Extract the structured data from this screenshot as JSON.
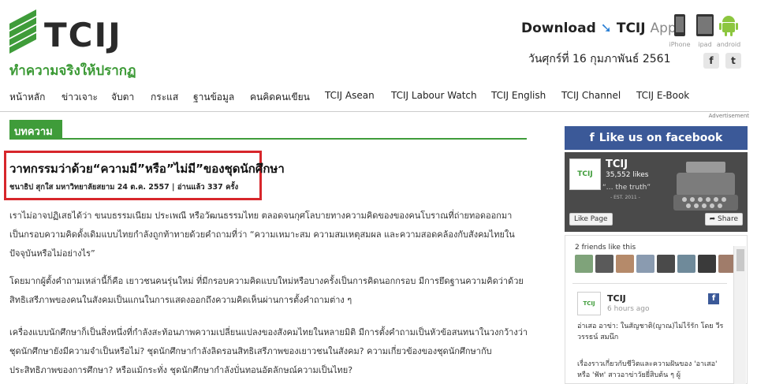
{
  "header": {
    "logo_text": "TCIJ",
    "tagline": "ทำความจริงให้ปรากฏ",
    "download": "Download",
    "download_brand": "TCIJ",
    "download_apps": "Apps",
    "devices": [
      "iPhone",
      "ipad",
      "android"
    ],
    "date": "วันศุกร์ที่ 16 กุมภาพันธ์ 2561",
    "social": {
      "facebook": "f",
      "twitter": "t"
    }
  },
  "nav": {
    "items": [
      "หน้าหลัก",
      "ข่าวเจาะ",
      "จับตา",
      "กระแส",
      "ฐานข้อมูล",
      "คนคิดคนเขียน",
      "TCIJ Asean",
      "TCIJ Labour Watch",
      "TCIJ English",
      "TCIJ Channel",
      "TCIJ E-Book"
    ],
    "advertisement": "Advertisement"
  },
  "article": {
    "section": "บทความ",
    "title": "วาทกรรมว่าด้วย“ความมี”หรือ”ไม่มี”ของชุดนักศึกษา",
    "meta": "ชนาธิป สุกใส มหาวิทยาลัยสยาม 24 ต.ค. 2557 | อ่านแล้ว 337 ครั้ง",
    "paragraphs": [
      "เราไม่อาจปฏิเสธได้ว่า ขนบธรรมเนียม ประเพณี หรือวัฒนธรรมไทย ตลอดจนกุศโลบายทางความคิดของของคนโบราณที่ถ่ายทอดออกมาเป็นกรอบความคิดดั้งเดิมแบบไทยกำลังถูกท้าทายด้วยคำถามที่ว่า “ความเหมาะสม ความสมเหตุสมผล และความสอดคล้องกับสังคมไทยในปัจจุบันหรือไม่อย่างไร”",
      "โดยมากผู้ตั้งคำถามเหล่านี้ก็คือ เยาวชนคนรุ่นใหม่ ที่มีกรอบความคิดแบบใหม่หรือบางครั้งเป็นการคิดนอกกรอบ มีการยึดฐานความคิดว่าด้วยสิทธิเสรีภาพของคนในสังคมเป็นแกนในการแสดงออกถึงความคิดเห็นผ่านการตั้งคำถามต่าง ๆ",
      "เครื่องแบบนักศึกษาก็เป็นสิ่งหนึ่งที่กำลังสะท้อนภาพความเปลี่ยนแปลงของสังคมไทยในหลายมิติ มีการตั้งคำถามเป็นหัวข้อสนทนาในวงกว้างว่า ชุดนักศึกษายังมีความจำเป็นหรือไม่? ชุดนักศึกษากำลังลิดรอนสิทธิเสรีภาพของเยาวชนในสังคม? ความเกี่ยวข้องของชุดนักศึกษากับประสิทธิภาพของการศึกษา? หรือแม้กระทั่ง ชุดนักศึกษากำลังบั่นทอนอัตลักษณ์ความเป็นไทย?"
    ]
  },
  "sidebar": {
    "like_banner": "Like us on facebook",
    "page_name": "TCIJ",
    "likes": "35,552 likes",
    "quote": "“… the truth”",
    "est": "- EST. 2011 -",
    "like_page": "Like Page",
    "share": "Share",
    "friends": "2 friends like this",
    "post": {
      "name": "TCIJ",
      "time": "6 hours ago",
      "text": "อ่าเสอ อาข่า: ในสัญชาติ(ญาณ)ไม่ไร้รัก โดย วีรวรรธน์ สมนึก",
      "text2": "เรื่องราวเกี่ยวกับชีวิตและความฝันของ 'อาเสอ' หรือ 'ฟัท' สาวอาข่าวัยยี่สิบต้น ๆ ผู้"
    }
  },
  "colors": {
    "brand_green": "#3f9c3a",
    "fb_blue": "#3b5998",
    "highlight_red": "#d7262b"
  }
}
